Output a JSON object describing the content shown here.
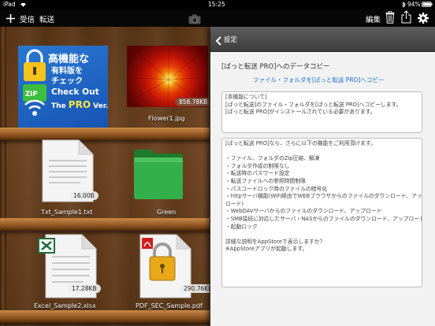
{
  "status_bar": {
    "carrier": "iPad",
    "time": "15:25",
    "battery": "94%"
  },
  "toolbar": {
    "receive_label": "受信",
    "transfer_label": "転送",
    "edit_label": "編集"
  },
  "files": [
    {
      "name": "",
      "size": "",
      "kind": "promo-banner"
    },
    {
      "name": "Flower1.jpg",
      "size": "858.78KB",
      "kind": "photo"
    },
    {
      "name": "Txt_Sample1.txt",
      "size": "16.00B",
      "kind": "text"
    },
    {
      "name": "Green",
      "size": "",
      "kind": "folder"
    },
    {
      "name": "Excel_Sample2.xlsx",
      "size": "17.28KB",
      "kind": "excel"
    },
    {
      "name": "PDF_SEC_Sample.pdf",
      "size": "290.76KB",
      "kind": "pdf-locked"
    }
  ],
  "promo_banner": {
    "line1": "高機能な",
    "line2": "有料版を",
    "line3": "チェック",
    "line4": "Check Out",
    "line5a": "The ",
    "line5b": "PRO",
    "line5c": " Ver.",
    "zip_label": "ZIP"
  },
  "panel": {
    "back_label": "設定",
    "title": "[ぱっと転送 PRO]へのデータコピー",
    "copy_link": "ファイル・フォルダを[ぱっと転送 PRO]へコピー",
    "info_lines": [
      "[本機能について]",
      "[ぱっと転送]のファイル・フォルダを[ぱっと転送 PRO]へコピーします。",
      "[ぱっと転送 PRO]がインストールされている必要があります。"
    ],
    "features_lines": [
      "[ぱっと転送 PRO]なら、さらに以下の機能をご利用頂けます。",
      "",
      "・ファイル、フォルダのZip圧縮、解凍",
      "・フォルダ作成の制限なし",
      "・転送時のパスワード設定",
      "・転送ファイルへの参照時間制限",
      "・パスコードロック時のファイルの暗号化",
      "・httpサーバ機能(WiFi経由でWEBブラウザからのファイルのダウンロード、アップ",
      "ロード)",
      "・WebDAVサーバからのファイルのダウンロード、アップロード",
      "・SMB接続に対応したサーバ・NASからのファイルのダウンロード、アップロード",
      "・起動ロック",
      "",
      "詳細な説明をAppStoreで表示しますか？",
      "※AppStoreアプリが起動します。"
    ]
  },
  "colors": {
    "accent": "#1a6fd0",
    "toolbar_bg": "#070707",
    "panel_bg": "#f2f2f2"
  }
}
